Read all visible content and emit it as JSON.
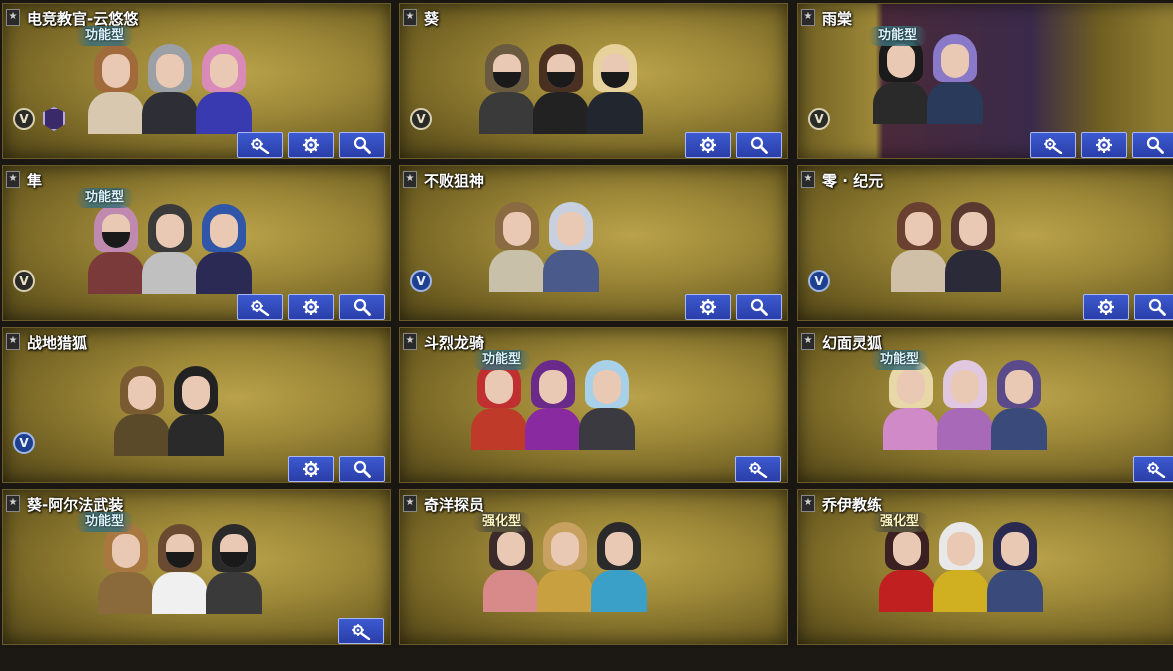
{
  "cards": [
    {
      "name": "电竞教官-云悠悠",
      "tag": "功能型",
      "tag_type": "func",
      "badges": [
        "v",
        "shield"
      ],
      "buttons": [
        "tune",
        "gear",
        "search"
      ]
    },
    {
      "name": "葵",
      "tag": "",
      "tag_type": "",
      "badges": [
        "v"
      ],
      "buttons": [
        "gear",
        "search"
      ]
    },
    {
      "name": "雨棠",
      "tag": "功能型",
      "tag_type": "func",
      "badges": [
        "v"
      ],
      "buttons": [
        "tune",
        "gear",
        "search"
      ]
    },
    {
      "name": "隼",
      "tag": "功能型",
      "tag_type": "func",
      "badges": [
        "v"
      ],
      "buttons": [
        "tune",
        "gear",
        "search"
      ]
    },
    {
      "name": "不败狙神",
      "tag": "",
      "tag_type": "",
      "badges": [
        "v-blue"
      ],
      "buttons": [
        "gear",
        "search"
      ]
    },
    {
      "name": "零 · 纪元",
      "tag": "",
      "tag_type": "",
      "badges": [
        "v-blue"
      ],
      "buttons": [
        "gear",
        "search"
      ]
    },
    {
      "name": "战地猎狐",
      "tag": "",
      "tag_type": "",
      "badges": [
        "v-blue"
      ],
      "buttons": [
        "gear",
        "search"
      ]
    },
    {
      "name": "斗烈龙骑",
      "tag": "功能型",
      "tag_type": "func",
      "badges": [],
      "buttons": [
        "tune"
      ]
    },
    {
      "name": "幻面灵狐",
      "tag": "功能型",
      "tag_type": "func",
      "badges": [],
      "buttons": [
        "tune"
      ]
    },
    {
      "name": "葵-阿尔法武装",
      "tag": "功能型",
      "tag_type": "func",
      "badges": [],
      "buttons": [
        "tune"
      ]
    },
    {
      "name": "奇洋探员",
      "tag": "强化型",
      "tag_type": "strong",
      "badges": [],
      "buttons": []
    },
    {
      "name": "乔伊教练",
      "tag": "强化型",
      "tag_type": "strong",
      "badges": [],
      "buttons": []
    }
  ],
  "icons": {
    "rank": "rank-star-icon",
    "tune": "tune-wrench-icon",
    "gear": "gear-icon",
    "search": "magnifier-icon",
    "v": "v-badge-icon",
    "shield": "shield-badge-icon"
  },
  "colors": {
    "card_gold": "#9d8838",
    "button_blue": "#3c5ad0",
    "tag_func": "#d9f3ff",
    "tag_strong": "#fff5c0"
  }
}
